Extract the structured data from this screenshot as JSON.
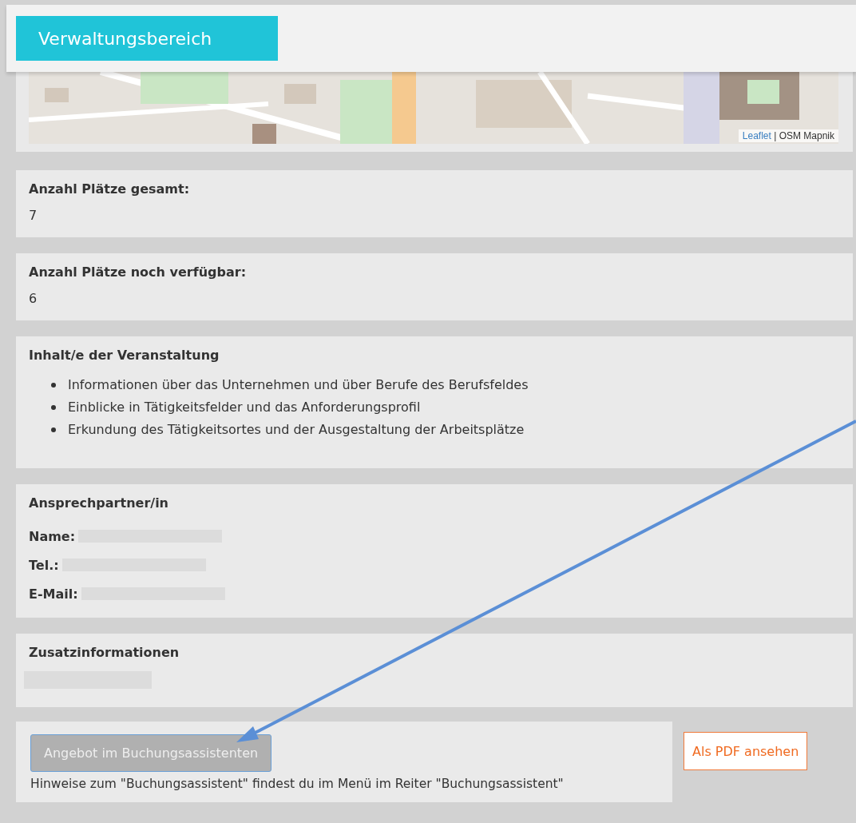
{
  "header": {
    "button": "Verwaltungsbereich"
  },
  "map": {
    "kind": "picture",
    "attribution_link": "Leaflet",
    "attribution_text": "| OSM Mapnik"
  },
  "fields": [
    {
      "kind": "value",
      "label": "Anzahl Plätze gesamt:",
      "value": "7"
    },
    {
      "kind": "value",
      "label": "Anzahl Plätze noch verfügbar:",
      "value": "6"
    },
    {
      "kind": "list",
      "label": "Inhalt/e der Veranstaltung",
      "items": [
        "Informationen über das Unternehmen und über Berufe des Berufsfeldes",
        "Einblicke in Tätigkeitsfelder und das Anforderungsprofil",
        "Erkundung des Tätigkeitsortes und der Ausgestaltung der Arbeitsplätze"
      ]
    },
    {
      "kind": "contact",
      "label": "Ansprechpartner/in",
      "rows": [
        {
          "label": "Name:"
        },
        {
          "label": "Tel.:"
        },
        {
          "label": "E-Mail:"
        }
      ]
    },
    {
      "kind": "redacted",
      "label": "Zusatzinformationen"
    }
  ],
  "booking": {
    "button": "Angebot im Buchungsassistenten",
    "disabled": true,
    "hint": "Hinweise zum \"Buchungsassistent\" findest du im Menü im Reiter \"Buchungsassistent\""
  },
  "pdf_button": "Als PDF ansehen"
}
